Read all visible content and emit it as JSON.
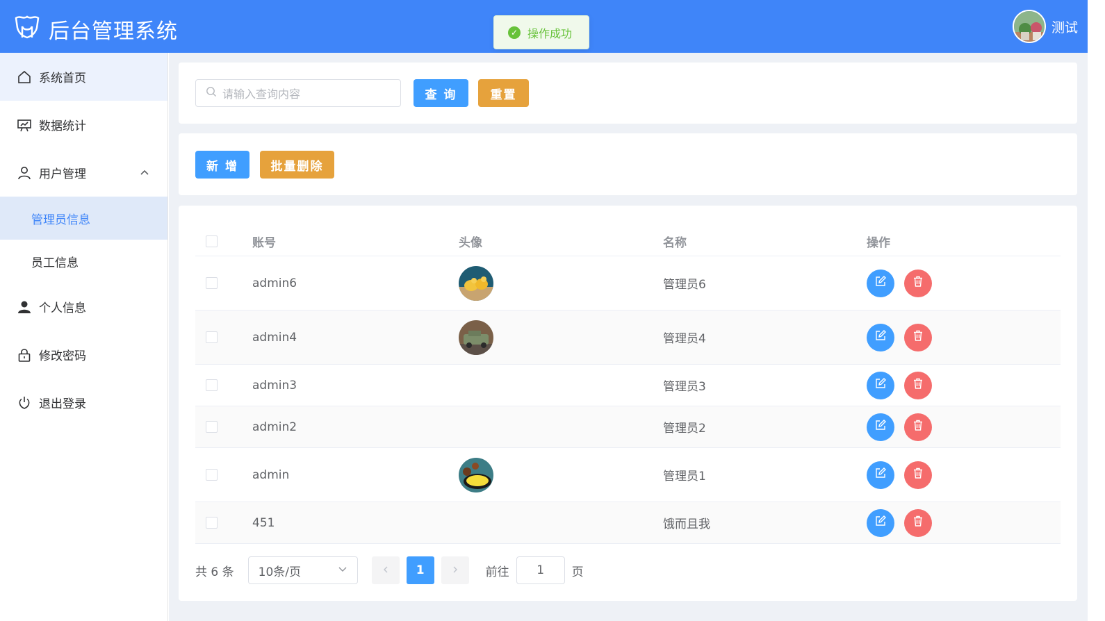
{
  "app": {
    "title": "后台管理系统"
  },
  "header": {
    "user_name": "测试"
  },
  "toast": {
    "message": "操作成功"
  },
  "sidebar": {
    "items": [
      {
        "label": "系统首页",
        "icon": "home-icon"
      },
      {
        "label": "数据统计",
        "icon": "chart-board-icon"
      },
      {
        "label": "用户管理",
        "icon": "user-icon"
      },
      {
        "label": "管理员信息"
      },
      {
        "label": "员工信息"
      },
      {
        "label": "个人信息",
        "icon": "user-filled-icon"
      },
      {
        "label": "修改密码",
        "icon": "lock-icon"
      },
      {
        "label": "退出登录",
        "icon": "power-icon"
      }
    ]
  },
  "search": {
    "placeholder": "请输入查询内容",
    "query_label": "查 询",
    "reset_label": "重置"
  },
  "ops": {
    "add_label": "新 增",
    "batch_delete_label": "批量删除"
  },
  "table": {
    "headers": {
      "account": "账号",
      "avatar": "头像",
      "name": "名称",
      "actions": "操作"
    },
    "rows": [
      {
        "account": "admin6",
        "name": "管理员6",
        "has_avatar": true
      },
      {
        "account": "admin4",
        "name": "管理员4",
        "has_avatar": true
      },
      {
        "account": "admin3",
        "name": "管理员3",
        "has_avatar": false
      },
      {
        "account": "admin2",
        "name": "管理员2",
        "has_avatar": false
      },
      {
        "account": "admin",
        "name": "管理员1",
        "has_avatar": true
      },
      {
        "account": "451",
        "name": "饿而且我",
        "has_avatar": false
      }
    ]
  },
  "pagination": {
    "total_text": "共 6 条",
    "page_size": "10条/页",
    "current_page": "1",
    "goto_label": "前往",
    "goto_value": "1",
    "page_suffix": "页"
  },
  "colors": {
    "header": "#3f85f9",
    "primary": "#409eff",
    "warning": "#e6a23c",
    "danger": "#f56c6c",
    "success": "#67c23a"
  }
}
